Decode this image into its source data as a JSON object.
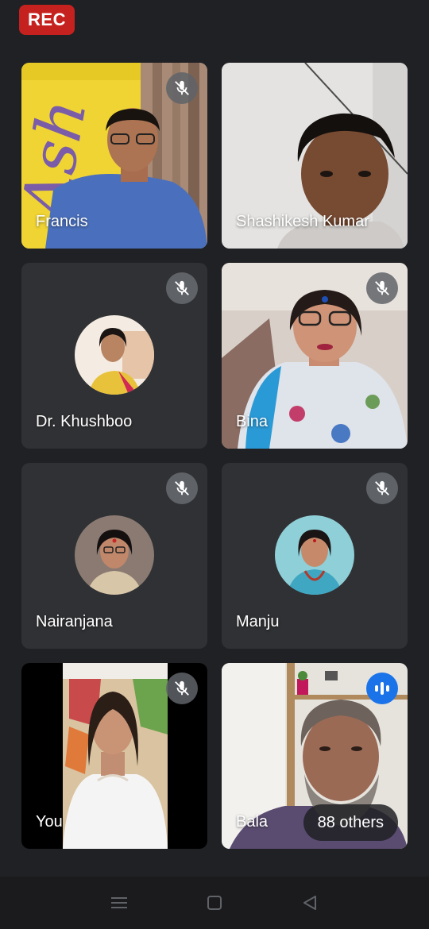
{
  "recording": {
    "label": "REC",
    "color": "#c5221f"
  },
  "participants": [
    {
      "name": "Francis",
      "muted": true,
      "video": true
    },
    {
      "name": "Shashikesh Kumar",
      "muted": false,
      "video": true
    },
    {
      "name": "Dr. Khushboo",
      "muted": true,
      "video": false
    },
    {
      "name": "Bina",
      "muted": true,
      "video": true
    },
    {
      "name": "Nairanjana",
      "muted": true,
      "video": false
    },
    {
      "name": "Manju",
      "muted": true,
      "video": false
    },
    {
      "name": "You",
      "muted": true,
      "video": true
    },
    {
      "name": "Bala",
      "muted": false,
      "speaking": true,
      "video": true
    }
  ],
  "others": {
    "label": "88 others"
  },
  "icons": {
    "mic_off": "mic-off-icon",
    "speaking": "audio-wave-icon",
    "nav_menu": "menu-icon",
    "nav_home": "home-square-icon",
    "nav_back": "back-triangle-icon"
  },
  "colors": {
    "tile": "#3c4043",
    "background": "#202124",
    "speaking": "#1a73e8"
  }
}
